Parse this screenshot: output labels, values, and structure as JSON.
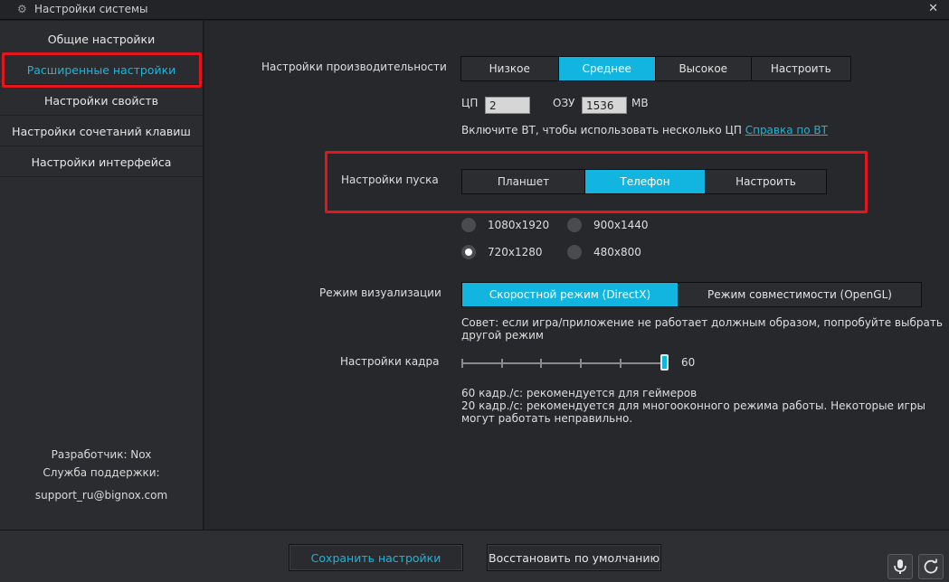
{
  "window": {
    "title": "Настройки системы",
    "gear_icon": "gear-icon",
    "close_label": "✕"
  },
  "sidebar": {
    "items": [
      {
        "label": "Общие настройки",
        "active": false
      },
      {
        "label": "Расширенные настройки",
        "active": true
      },
      {
        "label": "Настройки свойств",
        "active": false
      },
      {
        "label": "Настройки сочетаний клавиш",
        "active": false
      },
      {
        "label": "Настройки интерфейса",
        "active": false
      }
    ],
    "developer": "Разработчик: Nox",
    "support_label": "Служба поддержки:",
    "support_email": "support_ru@bignox.com"
  },
  "performance": {
    "label": "Настройки производительности",
    "options": [
      "Низкое",
      "Среднее",
      "Высокое",
      "Настроить"
    ],
    "selected": "Среднее",
    "cpu_label": "ЦП",
    "cpu_value": "2",
    "ram_label": "ОЗУ",
    "ram_value": "1536",
    "ram_unit": "MB",
    "vt_hint": "Включите ВТ, чтобы использовать несколько ЦП",
    "vt_link": "Справка по ВТ"
  },
  "startup": {
    "label": "Настройки пуска",
    "options": [
      "Планшет",
      "Телефон",
      "Настроить"
    ],
    "selected": "Телефон",
    "resolutions": [
      "1080x1920",
      "900x1440",
      "720x1280",
      "480x800"
    ],
    "selected_resolution": "720x1280"
  },
  "render": {
    "label": "Режим визуализации",
    "options": [
      "Скоростной режим (DirectX)",
      "Режим совместимости (OpenGL)"
    ],
    "selected": "Скоростной режим (DirectX)",
    "hint_line1": "Совет: если игра/приложение не работает должным образом, попробуйте выбрать",
    "hint_line2": "другой режим"
  },
  "frame": {
    "label": "Настройки кадра",
    "value": "60",
    "note1": "60 кадр./с: рекомендуется для геймеров",
    "note2": "20 кадр./с: рекомендуется для многооконного режима работы. Некоторые игры",
    "note3": "могут работать неправильно."
  },
  "footer": {
    "save_label": "Сохранить настройки",
    "reset_label": "Восстановить по умолчанию",
    "mic_icon": "microphone-icon",
    "refresh_icon": "refresh-icon"
  },
  "colors": {
    "accent": "#12b5df",
    "highlight": "#e2161c"
  }
}
